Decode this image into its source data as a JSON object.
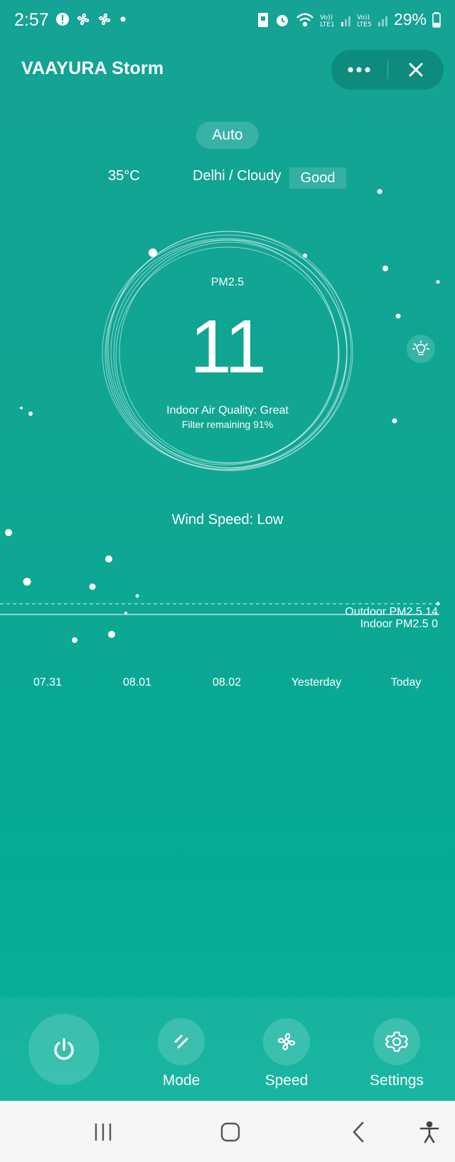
{
  "status_bar": {
    "time": "2:57",
    "battery": "29%",
    "icons": [
      "alert-icon",
      "fan-icon",
      "fan-icon",
      "dot-icon",
      "sim-icon",
      "alarm-icon",
      "wifi-icon",
      "signal-icon",
      "signal-icon",
      "battery-icon"
    ]
  },
  "header": {
    "title": "VAAYURA Storm"
  },
  "status": {
    "mode": "Auto",
    "temperature": "35°C",
    "location_weather": "Delhi / Cloudy",
    "outdoor_quality": "Good"
  },
  "gauge": {
    "label": "PM2.5",
    "value": "11",
    "air_quality": "Indoor Air Quality: Great",
    "filter": "Filter remaining 91%"
  },
  "wind_speed": "Wind Speed: Low",
  "chart_data": {
    "type": "line",
    "categories": [
      "07.31",
      "08.01",
      "08.02",
      "Yesterday",
      "Today"
    ],
    "series": [
      {
        "name": "Outdoor PM2.5",
        "latest_label": "Outdoor PM2.5 14",
        "latest": 14
      },
      {
        "name": "Indoor PM2.5",
        "latest_label": "Indoor PM2.5 0",
        "latest": 0
      }
    ]
  },
  "controls": {
    "mode_label": "Mode",
    "speed_label": "Speed",
    "settings_label": "Settings"
  },
  "colors": {
    "background": "#10a693",
    "accent": "#ffffff"
  }
}
